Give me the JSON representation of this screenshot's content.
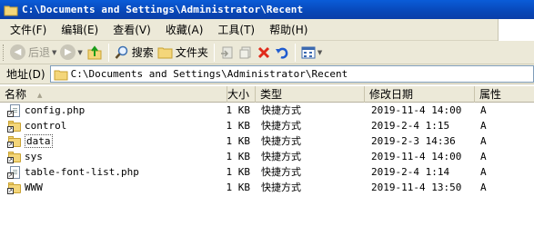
{
  "window": {
    "title": "C:\\Documents and Settings\\Administrator\\Recent"
  },
  "menubar": {
    "items": [
      "文件(F)",
      "编辑(E)",
      "查看(V)",
      "收藏(A)",
      "工具(T)",
      "帮助(H)"
    ]
  },
  "toolbar": {
    "back_label": "后退",
    "search_label": "搜索",
    "folders_label": "文件夹"
  },
  "addressbar": {
    "label": "地址(D)",
    "path": "C:\\Documents and Settings\\Administrator\\Recent"
  },
  "list": {
    "columns": {
      "name": "名称",
      "size": "大小",
      "type": "类型",
      "modified": "修改日期",
      "attributes": "属性"
    },
    "rows": [
      {
        "name": "config.php",
        "icon": "document-shortcut-icon",
        "size": "1 KB",
        "type": "快捷方式",
        "modified": "2019-11-4 14:00",
        "attr": "A"
      },
      {
        "name": "control",
        "icon": "folder-shortcut-icon",
        "size": "1 KB",
        "type": "快捷方式",
        "modified": "2019-2-4 1:15",
        "attr": "A"
      },
      {
        "name": "data",
        "icon": "folder-shortcut-icon",
        "size": "1 KB",
        "type": "快捷方式",
        "modified": "2019-2-3 14:36",
        "attr": "A"
      },
      {
        "name": "sys",
        "icon": "folder-shortcut-icon",
        "size": "1 KB",
        "type": "快捷方式",
        "modified": "2019-11-4 14:00",
        "attr": "A"
      },
      {
        "name": "table-font-list.php",
        "icon": "document-shortcut-icon",
        "size": "1 KB",
        "type": "快捷方式",
        "modified": "2019-2-4 1:14",
        "attr": "A"
      },
      {
        "name": "WWW",
        "icon": "folder-shortcut-icon",
        "size": "1 KB",
        "type": "快捷方式",
        "modified": "2019-11-4 13:50",
        "attr": "A"
      }
    ]
  },
  "colors": {
    "titlebar": "#0847b8",
    "chrome": "#ece9d8",
    "folder": "#f4d67a"
  }
}
